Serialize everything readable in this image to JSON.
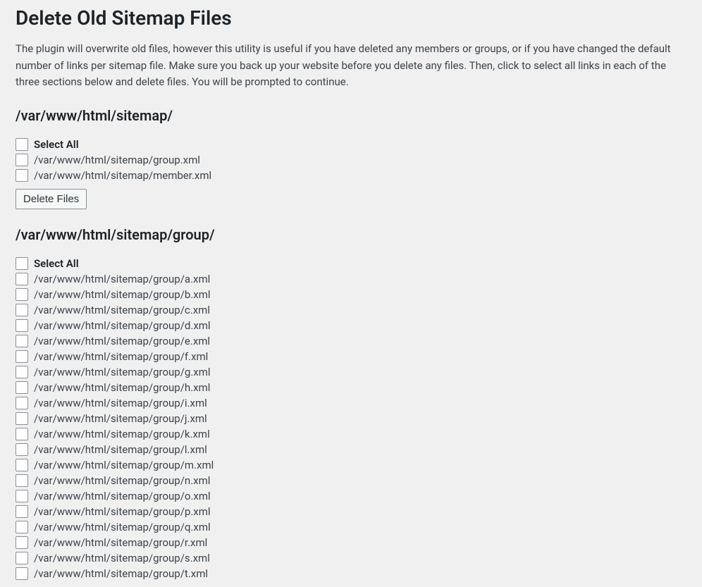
{
  "page": {
    "title": "Delete Old Sitemap Files",
    "description": "The plugin will overwrite old files, however this utility is useful if you have deleted any members or groups, or if you have changed the default number of links per sitemap file. Make sure you back up your website before you delete any files. Then, click to select all links in each of the three sections below and delete files. You will be prompted to continue."
  },
  "labels": {
    "select_all": "Select All",
    "delete_files": "Delete Files"
  },
  "sections": [
    {
      "path": "/var/www/html/sitemap/",
      "files": [
        "/var/www/html/sitemap/group.xml",
        "/var/www/html/sitemap/member.xml"
      ],
      "show_delete": true
    },
    {
      "path": "/var/www/html/sitemap/group/",
      "files": [
        "/var/www/html/sitemap/group/a.xml",
        "/var/www/html/sitemap/group/b.xml",
        "/var/www/html/sitemap/group/c.xml",
        "/var/www/html/sitemap/group/d.xml",
        "/var/www/html/sitemap/group/e.xml",
        "/var/www/html/sitemap/group/f.xml",
        "/var/www/html/sitemap/group/g.xml",
        "/var/www/html/sitemap/group/h.xml",
        "/var/www/html/sitemap/group/i.xml",
        "/var/www/html/sitemap/group/j.xml",
        "/var/www/html/sitemap/group/k.xml",
        "/var/www/html/sitemap/group/l.xml",
        "/var/www/html/sitemap/group/m.xml",
        "/var/www/html/sitemap/group/n.xml",
        "/var/www/html/sitemap/group/o.xml",
        "/var/www/html/sitemap/group/p.xml",
        "/var/www/html/sitemap/group/q.xml",
        "/var/www/html/sitemap/group/r.xml",
        "/var/www/html/sitemap/group/s.xml",
        "/var/www/html/sitemap/group/t.xml"
      ],
      "show_delete": false
    }
  ]
}
